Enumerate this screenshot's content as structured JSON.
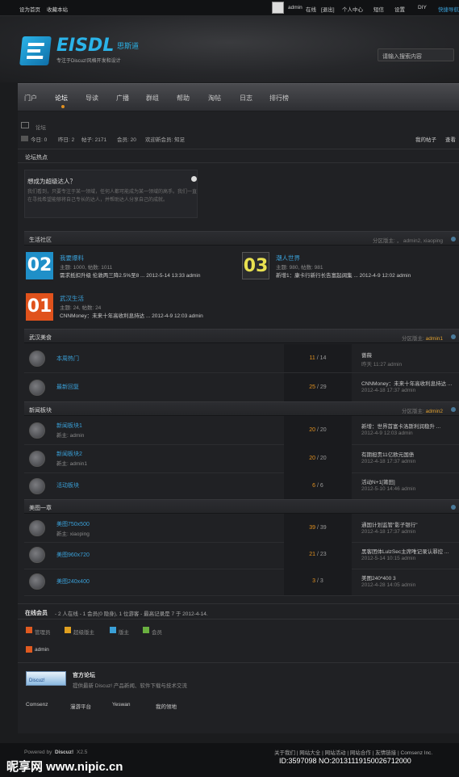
{
  "topbar": {
    "set_home": "设为首页",
    "bookmark": "收藏本站",
    "user": "admin",
    "online": "在线",
    "logout": "[退出]",
    "personal": "个人中心",
    "sms": "短信",
    "settings": "设置",
    "diy": "DIY",
    "quick_nav": "快捷导航"
  },
  "header": {
    "logo": "EISDL",
    "logo_cn": "思斯道",
    "tagline": "专注于Discuz!风格开发和设计",
    "search_placeholder": "请输入搜索内容"
  },
  "nav": [
    "门户",
    "论坛",
    "导读",
    "广播",
    "群组",
    "帮助",
    "淘帖",
    "日志",
    "排行榜"
  ],
  "breadcrumb": "论坛",
  "stats": {
    "today": "今日: 0",
    "yesterday": "昨日: 2",
    "posts": "帖子: 2171",
    "members": "会员: 20",
    "welcome": "欢迎新会员: 知足",
    "my_posts": "我的帖子",
    "view": "查看"
  },
  "hot": {
    "title": "论坛热点",
    "q_title": "想成为超级达人？",
    "q_text": "我们看到，只要专注于某一领域，任何人都可能成为某一领域的高手。我们一直在寻找希望能够将自己专长的达人，并帮助达人分享自己的成就。"
  },
  "sec1": {
    "title": "生活社区",
    "mods": "分区版主: ， admin2, xiaoping"
  },
  "forums1": [
    {
      "icon": "02",
      "name": "我要爆料",
      "meta": "主题: 1000, 帖数: 1011",
      "last": "需求抵扣升级 伦敦两三降2.5%至8 ... 2012-5-14 13:33 admin",
      "color": "#1f8fc8"
    },
    {
      "icon": "03",
      "name": "潮人世界",
      "meta": "主题: 980, 帖数: 981",
      "last": "新增1：康卡行新行长告富起阔集 ... 2012-4-9 12:02 admin",
      "color": "#2a2b2e"
    },
    {
      "icon": "01",
      "name": "武汉生活",
      "meta": "主题: 24, 帖数: 24",
      "last": "CNNMoney：未来十年高收利息持达 ... 2012-4-9 12:03 admin",
      "color": "#e0521c"
    }
  ],
  "sec2": {
    "title": "武汉美食",
    "mods_label": "分区版主: ",
    "mods": "admin1"
  },
  "rows2": [
    {
      "name": "本周热门",
      "sub": "",
      "count_a": "11",
      "count_b": " / 14",
      "lt": "蔷薇",
      "ld": "昨天 11:27 admin"
    },
    {
      "name": "最新回复",
      "sub": "",
      "count_a": "25",
      "count_b": " / 29",
      "lt": "CNNMoney：未来十年高收利息持达 ...",
      "ld": "2012-4-18 17:37 admin"
    }
  ],
  "sec3": {
    "title": "新闻板块",
    "mods_label": "分区版主: ",
    "mods": "admin2"
  },
  "rows3": [
    {
      "name": "新闻板块1",
      "sub": "新主: admin",
      "count_a": "20",
      "count_b": " / 20",
      "lt": "新增：世界首富卡洛斯利润稳升 ...",
      "ld": "2012-4-9 12:03 admin"
    },
    {
      "name": "新闻板块2",
      "sub": "新主: admin1",
      "count_a": "20",
      "count_b": " / 20",
      "lt": "有期担责11亿欧元国债",
      "ld": "2012-4-18 17:37 admin"
    },
    {
      "name": "活动板块",
      "sub": "",
      "count_a": "6",
      "count_b": " / 6",
      "lt": "活动N+1[莆田]",
      "ld": "2012-5-10 14:46 admin"
    }
  ],
  "sec4": {
    "title": "美图一章"
  },
  "rows4": [
    {
      "name": "美图750x500",
      "sub": "新主: xiaoping",
      "count_a": "39",
      "count_b": " / 39",
      "lt": "通国计划监管\"影子银行\"",
      "ld": "2012-4-18 17:37 admin"
    },
    {
      "name": "美图960x720",
      "sub": "",
      "count_a": "21",
      "count_b": " / 23",
      "lt": "黑客团体LulzSec主席唯记录认罪控 ...",
      "ld": "2012-5-14 10:15 admin"
    },
    {
      "name": "美图240x400",
      "sub": "",
      "count_a": "3",
      "count_b": " / 3",
      "lt": "美图240*400 3",
      "ld": "2012-4-28 14:05 admin"
    }
  ],
  "online": {
    "title": "在线会员",
    "text": "- 2 人在线 - 1 会员(0 隐身), 1 位游客 - 最高记录是 7 于 2012-4-14.",
    "legend": [
      "管理员",
      "超级版主",
      "版主",
      "会员"
    ],
    "user": "admin"
  },
  "links": {
    "title": "官方论坛",
    "desc": "提供最新 Discuz! 产品新闻、软件下载与技术交流",
    "logo": "Discuz!",
    "items": [
      "Comsenz",
      "漫游平台",
      "Yeswan",
      "我的领地"
    ]
  },
  "footer": {
    "powered": "Powered by",
    "discuz": "Discuz!",
    "ver": "X2.5",
    "links": "关于我们 | 网站大全 | 网站活动 | 网站合作 | 友情链接 | Comsenz Inc.",
    "wm": "昵享网 www.nipic.cn",
    "wmid": "ID:3597098 NO:20131119150026712000"
  },
  "colors": {
    "accent": "#3aa0d8",
    "orange": "#e09020",
    "bg": "#1b1c1e"
  }
}
